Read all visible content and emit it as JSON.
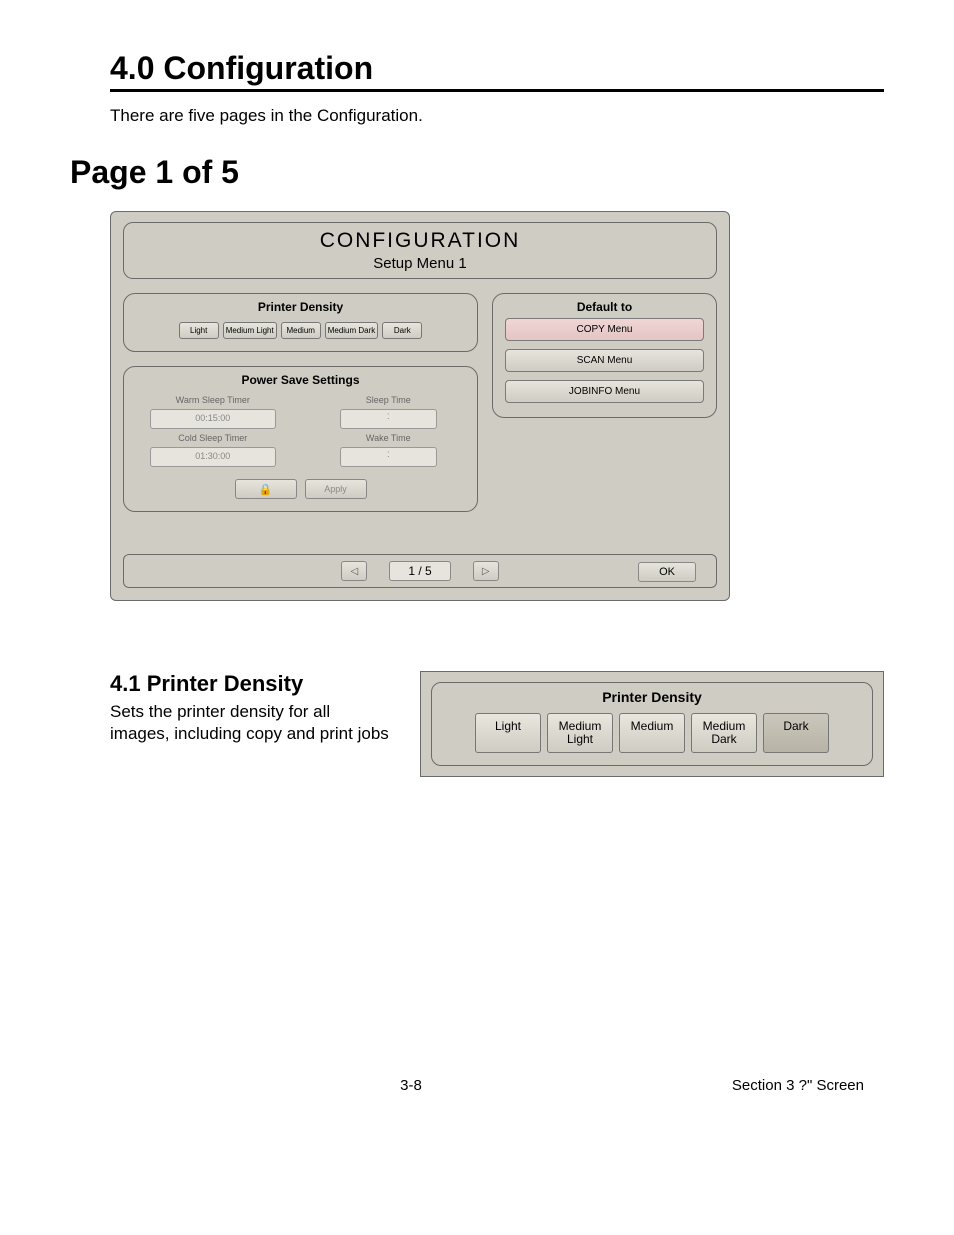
{
  "doc": {
    "section_heading": "4.0  Configuration",
    "intro": "There are five pages in the Configuration.",
    "page_heading": "Page 1 of 5",
    "subsection": {
      "heading": "4.1  Printer Density",
      "text": "Sets the printer density for all images, including copy and print jobs"
    },
    "footer": {
      "page": "3-8",
      "section": "Section 3    ?\" Screen"
    }
  },
  "panel": {
    "title": "CONFIGURATION",
    "subtitle": "Setup Menu 1",
    "printer_density": {
      "title": "Printer Density",
      "options": [
        "Light",
        "Medium Light",
        "Medium",
        "Medium Dark",
        "Dark"
      ]
    },
    "power_save": {
      "title": "Power Save Settings",
      "warm_label": "Warm Sleep Timer",
      "warm_value": "00:15:00",
      "cold_label": "Cold Sleep Timer",
      "cold_value": "01:30:00",
      "sleep_label": "Sleep Time",
      "wake_label": "Wake Time",
      "apply": "Apply"
    },
    "default_to": {
      "title": "Default to",
      "items": [
        "COPY Menu",
        "SCAN Menu",
        "JOBINFO Menu"
      ]
    },
    "pager": {
      "indicator": "1 / 5",
      "ok": "OK"
    }
  },
  "density_detail": {
    "title": "Printer Density",
    "options": [
      {
        "line1": "Light",
        "line2": ""
      },
      {
        "line1": "Medium",
        "line2": "Light"
      },
      {
        "line1": "Medium",
        "line2": ""
      },
      {
        "line1": "Medium",
        "line2": "Dark"
      },
      {
        "line1": "Dark",
        "line2": ""
      }
    ]
  }
}
